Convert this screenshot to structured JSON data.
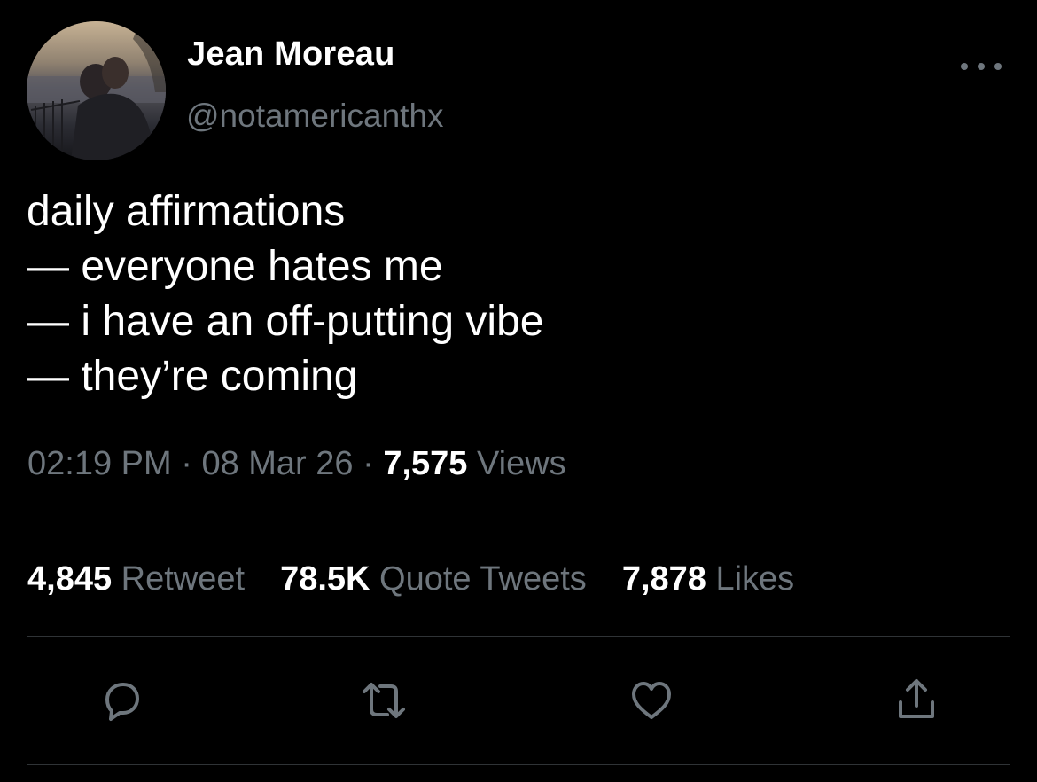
{
  "user": {
    "name": "Jean Moreau",
    "handle": "@notamericanthx"
  },
  "tweet": {
    "lines": [
      "daily affirmations",
      "— everyone hates me",
      "— i have an off-putting vibe",
      "— they’re coming"
    ],
    "time": "02:19 PM",
    "date": "08 Mar 26",
    "separator": "·",
    "views_count": "7,575",
    "views_label": "Views"
  },
  "stats": {
    "retweets_count": "4,845",
    "retweets_label": "Retweet",
    "quotes_count": "78.5K",
    "quotes_label": "Quote Tweets",
    "likes_count": "7,878",
    "likes_label": "Likes"
  },
  "actions": {
    "reply_icon": "speech-bubble-icon",
    "retweet_icon": "retweet-arrows-icon",
    "like_icon": "heart-icon",
    "share_icon": "share-upload-icon"
  },
  "colors": {
    "background": "#000000",
    "primary_text": "#ffffff",
    "secondary_text": "#6e767d",
    "divider": "#2f3336"
  }
}
